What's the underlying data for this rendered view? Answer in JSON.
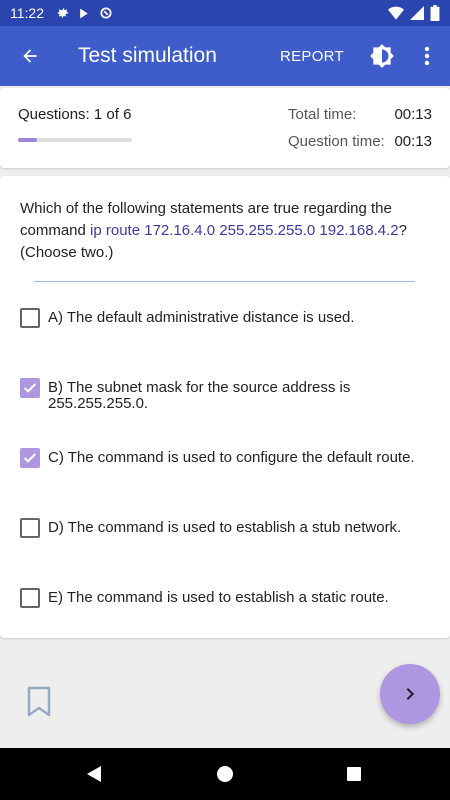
{
  "status_bar": {
    "time": "11:22"
  },
  "app_bar": {
    "title": "Test simulation",
    "report_label": "REPORT"
  },
  "info": {
    "questions_label": "Questions:",
    "questions_value": "1 of 6",
    "progress_fraction": 0.167,
    "total_time_label": "Total time:",
    "total_time_value": "00:13",
    "question_time_label": "Question time:",
    "question_time_value": "00:13"
  },
  "question": {
    "text_before": "Which of the following statements are true regarding the command ",
    "command": "ip route 172.16.4.0 255.255.255.0 192.168.4.2",
    "text_after": "? (Choose two.)"
  },
  "answers": [
    {
      "label": "A) The default administrative distance is used.",
      "checked": false
    },
    {
      "label": "B) The subnet mask for the source address is 255.255.255.0.",
      "checked": true
    },
    {
      "label": "C) The command is used to configure the default route.",
      "checked": true
    },
    {
      "label": "D) The command is used to establish a stub network.",
      "checked": false
    },
    {
      "label": "E) The command is used to establish a static route.",
      "checked": false
    }
  ],
  "icons": {
    "back": "arrow-back-icon",
    "theme": "brightness-icon",
    "more": "more-vert-icon",
    "bookmark": "bookmark-icon",
    "next": "chevron-right-icon"
  },
  "colors": {
    "status_bar": "#2a45ad",
    "app_bar": "#3f5ccb",
    "accent": "#ae96e0",
    "command_text": "#3a3aa0"
  }
}
